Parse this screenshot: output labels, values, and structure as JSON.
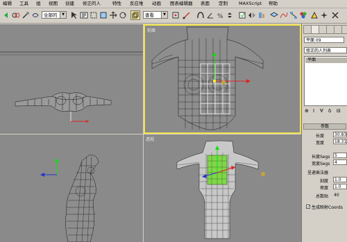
{
  "menu": [
    "编辑",
    "工具",
    "组",
    "视图",
    "创建",
    "修正的人",
    "特性",
    "反应堆",
    "动画",
    "图表编辑器",
    "表面",
    "定制",
    "MAXScript",
    "帮助"
  ],
  "toolbar": {
    "selection_filter": "全部的",
    "reference_coord": "查看"
  },
  "viewports": {
    "top_left": {
      "label": ""
    },
    "front": {
      "label": "前面"
    },
    "left": {
      "label": ""
    },
    "perspective": {
      "label": "透视"
    }
  },
  "command_panel": {
    "object_name": "平面 09",
    "modifier_list": "修正的人列表",
    "stack_item": "平面",
    "params_title": "参数",
    "length_label": "长度",
    "length_value": "30.83",
    "width_label": "宽度",
    "width_value": "18.31",
    "length_segs_label": "长度Segs",
    "length_segs_value": "5",
    "width_segs_label": "宽度Segs",
    "width_segs_value": "4",
    "render_mult_title": "呈递乘法器",
    "scale_label": "刻度",
    "scale_value": "1.0",
    "density_label": "密度",
    "density_value": "1.0",
    "total_faces_label": "总数贴",
    "total_faces_value": "40",
    "gen_mapping_label": "生成映射Coords"
  },
  "colors": {
    "viewport_bg": "#8a8a8a",
    "active_border": "#f2e34a",
    "ui_bg": "#d4d0c8",
    "selected_plane": "#7fd64a"
  }
}
